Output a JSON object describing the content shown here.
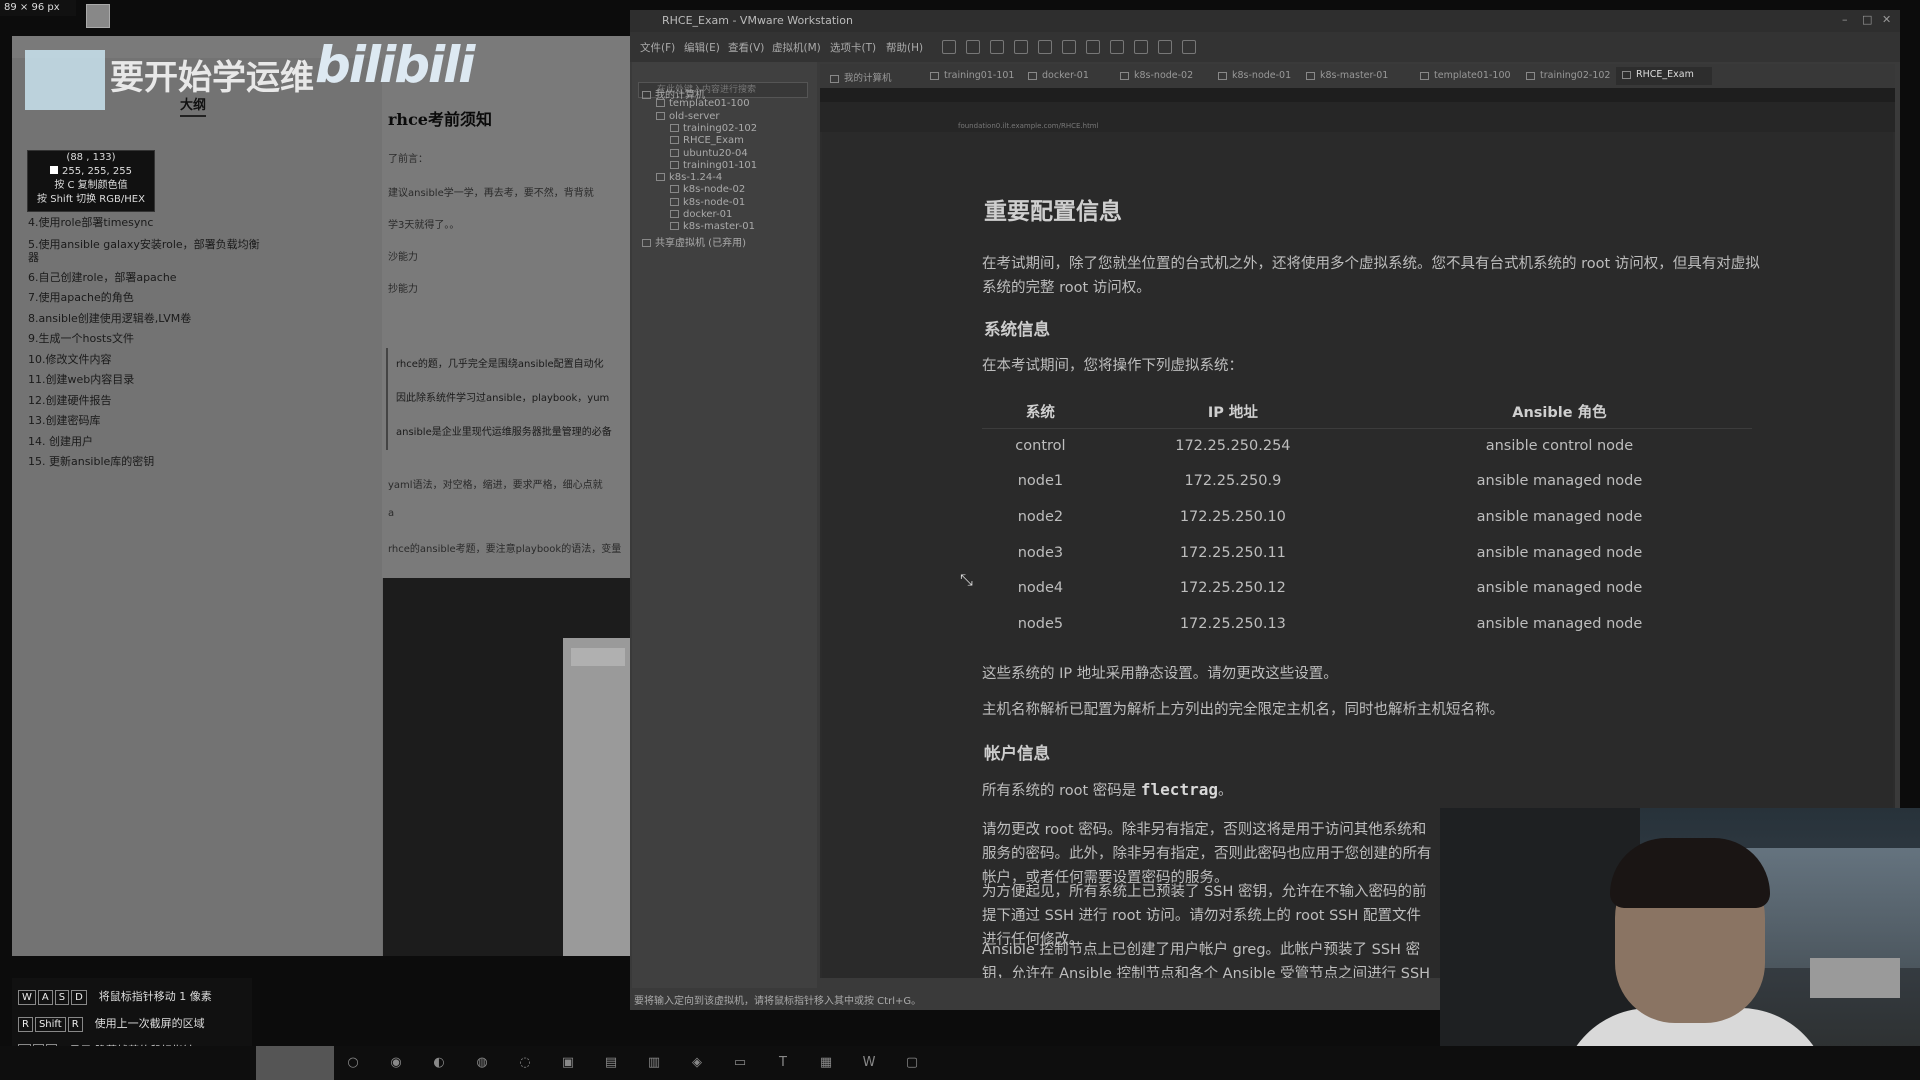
{
  "overlay": {
    "pixel_size": "89 × 96  px",
    "watermark_text": "要开始学运维",
    "watermark_brand": "bilibili",
    "picker_coords": "(88 , 133)",
    "picker_rgb": "255, 255, 255",
    "picker_hint1": "按 C 复制颜色值",
    "picker_hint2": "按 Shift 切换 RGB/HEX",
    "shortcuts": [
      {
        "keys": [
          "W",
          "A",
          "S",
          "D"
        ],
        "text": "将鼠标指针移动 1 像素"
      },
      {
        "keys": [
          "R",
          "Shift",
          "R"
        ],
        "text": "使用上一次截屏的区域"
      },
      {
        "keys": [
          "`",
          "/",
          "I"
        ],
        "text": "显示/隐藏捕获的鼠标指针"
      }
    ]
  },
  "notes": {
    "outline_title": "大纲",
    "outline_items": [
      "4.使用role部署timesync",
      "5.使用ansible galaxy安装role，部署负载均衡器",
      "6.自己创建role，部署apache",
      "7.使用apache的角色",
      "8.ansible创建使用逻辑卷,LVM卷",
      "9.生成一个hosts文件",
      "10.修改文件内容",
      "11.创建web内容目录",
      "12.创建硬件报告",
      "13.创建密码库",
      "14. 创建用户",
      "15. 更新ansible库的密钥"
    ],
    "doc_title": "rhce考前须知",
    "doc_lines": [
      "了前言：",
      "建议ansible学一学，再去考，要不然，背背就",
      "学3天就得了。。",
      "沙能力",
      "抄能力"
    ],
    "doc_quote": [
      "rhce的题，几乎完全是围绕ansible配置自动化",
      "因此除系统件学习过ansible，playbook，yum",
      "ansible是企业里现代运维服务器批量管理的必备"
    ],
    "doc_more": [
      "yaml语法，对空格，缩进，要求严格，细心点就",
      "a",
      "rhce的ansible考题，要注意playbook的语法，变量"
    ]
  },
  "vmware": {
    "title": "RHCE_Exam - VMware Workstation",
    "menu": [
      "文件(F)",
      "编辑(E)",
      "查看(V)",
      "虚拟机(M)",
      "选项卡(T)",
      "帮助(H)"
    ],
    "library_search": "在此处键入内容进行搜索",
    "library": [
      {
        "label": "我的计算机",
        "level": 0
      },
      {
        "label": "template01-100",
        "level": 1
      },
      {
        "label": "old-server",
        "level": 1
      },
      {
        "label": "training02-102",
        "level": 2
      },
      {
        "label": "RHCE_Exam",
        "level": 2
      },
      {
        "label": "ubuntu20-04",
        "level": 2
      },
      {
        "label": "training01-101",
        "level": 2
      },
      {
        "label": "k8s-1.24-4",
        "level": 1
      },
      {
        "label": "k8s-node-02",
        "level": 2
      },
      {
        "label": "k8s-node-01",
        "level": 2
      },
      {
        "label": "docker-01",
        "level": 2
      },
      {
        "label": "k8s-master-01",
        "level": 2
      },
      {
        "label": "共享虚拟机 (已弃用)",
        "level": 0
      }
    ],
    "tabs": [
      "我的计算机",
      "training01-101",
      "docker-01",
      "k8s-node-02",
      "k8s-node-01",
      "k8s-master-01",
      "template01-100",
      "training02-102",
      "RHCE_Exam"
    ],
    "active_tab": "RHCE_Exam",
    "browser_url": "foundation0.ilt.example.com/RHCE.html",
    "status": "要将输入定向到该虚拟机，请将鼠标指针移入其中或按 Ctrl+G。"
  },
  "exam_page": {
    "heading": "重要配置信息",
    "intro": "在考试期间，除了您就坐位置的台式机之外，还将使用多个虚拟系统。您不具有台式机系统的 root 访问权，但具有对虚拟系统的完整 root 访问权。",
    "sys_heading": "系统信息",
    "sys_intro": "在本考试期间，您将操作下列虚拟系统：",
    "table_headers": [
      "系统",
      "IP 地址",
      "Ansible 角色"
    ],
    "table_rows": [
      [
        "control",
        "172.25.250.254",
        "ansible control node"
      ],
      [
        "node1",
        "172.25.250.9",
        "ansible managed node"
      ],
      [
        "node2",
        "172.25.250.10",
        "ansible managed node"
      ],
      [
        "node3",
        "172.25.250.11",
        "ansible managed node"
      ],
      [
        "node4",
        "172.25.250.12",
        "ansible managed node"
      ],
      [
        "node5",
        "172.25.250.13",
        "ansible managed node"
      ]
    ],
    "note1": "这些系统的 IP 地址采用静态设置。请勿更改这些设置。",
    "note2": "主机名称解析已配置为解析上方列出的完全限定主机名，同时也解析主机短名称。",
    "acct_heading": "帐户信息",
    "pw_prefix": "所有系统的 root 密码是",
    "pw": "flectrag",
    "pw_suffix": "。",
    "pw_note": "请勿更改 root 密码。除非另有指定，否则这将是用于访问其他系统和服务的密码。此外，除非另有指定，否则此密码也应用于您创建的所有帐户，或者任何需要设置密码的服务。",
    "ssh_note": "为方便起见，所有系统上已预装了 SSH 密钥，允许在不输入密码的前提下通过 SSH 进行 root 访问。请勿对系统上的 root SSH 配置文件进行任何修改。",
    "greg_note": "Ansible 控制节点上已创建了用户帐户 greg。此帐户预装了 SSH 密钥，允许在 Ansible 控制节点和各个 Ansible 受管节点之间进行 SSH 登录。请勿对系统上的 greg SSH 配置文件进行任何修改。"
  }
}
